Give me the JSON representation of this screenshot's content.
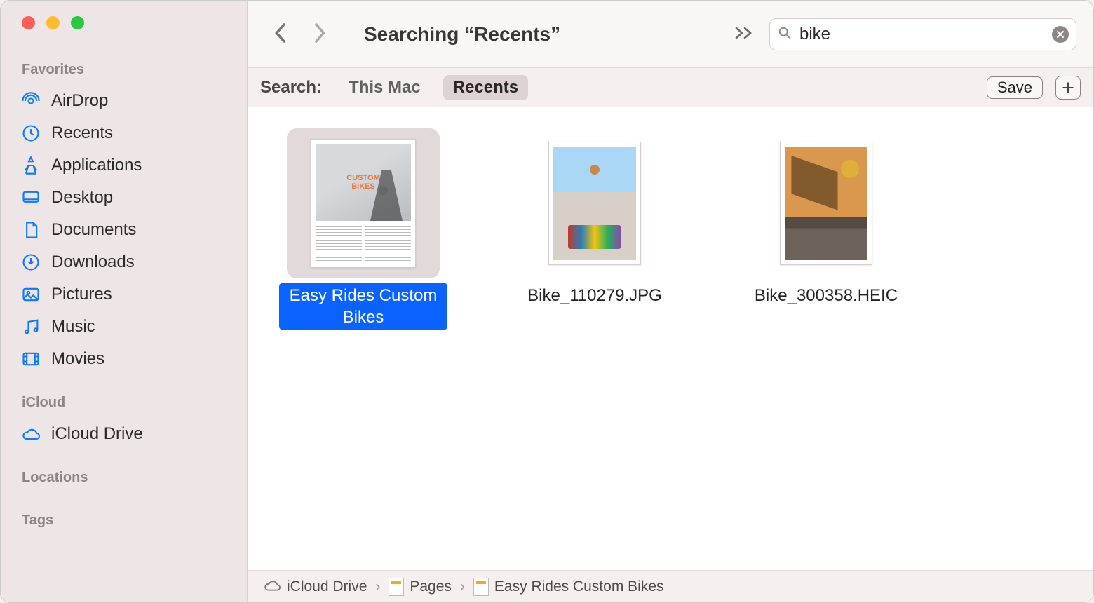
{
  "window": {
    "title": "Searching “Recents”"
  },
  "sidebar": {
    "sections": {
      "favorites": {
        "header": "Favorites",
        "items": [
          {
            "label": "AirDrop"
          },
          {
            "label": "Recents"
          },
          {
            "label": "Applications"
          },
          {
            "label": "Desktop"
          },
          {
            "label": "Documents"
          },
          {
            "label": "Downloads"
          },
          {
            "label": "Pictures"
          },
          {
            "label": "Music"
          },
          {
            "label": "Movies"
          }
        ]
      },
      "icloud": {
        "header": "iCloud",
        "items": [
          {
            "label": "iCloud Drive"
          }
        ]
      },
      "locations": {
        "header": "Locations"
      },
      "tags": {
        "header": "Tags"
      }
    }
  },
  "search": {
    "value": "bike"
  },
  "scope": {
    "label": "Search:",
    "options": [
      "This Mac",
      "Recents"
    ],
    "active_index": 1,
    "save_label": "Save",
    "add_label": "+"
  },
  "files": [
    {
      "name": "Easy Rides Custom Bikes",
      "selected": true,
      "kind": "doc",
      "doc_heading": "CUSTOM\nBIKES"
    },
    {
      "name": "Bike_110279.JPG",
      "selected": false,
      "kind": "img1"
    },
    {
      "name": "Bike_300358.HEIC",
      "selected": false,
      "kind": "img2"
    }
  ],
  "pathbar": {
    "segments": [
      "iCloud Drive",
      "Pages",
      "Easy Rides Custom Bikes"
    ]
  }
}
